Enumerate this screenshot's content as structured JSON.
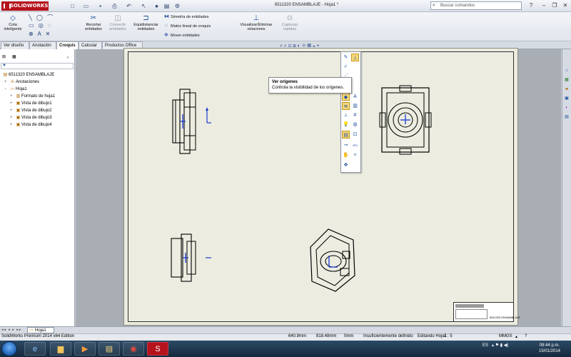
{
  "app": {
    "brand": "SOLIDWORKS",
    "doc_title": "6511320 ENSAMBLAJE - Hoja1 *"
  },
  "search": {
    "placeholder": "Buscar comandos"
  },
  "ribbon": {
    "cota_label": "Cota inteligente",
    "recortar_label": "Recortar entidades",
    "convertir_label": "Convertir entidades",
    "equidistanciar_label": "Equidistanciar entidades",
    "simetria_label": "Simetría de entidades",
    "matriz_label": "Matriz lineal de croquis",
    "mover_label": "Mover entidades",
    "relaciones_label": "Visualizar/Eliminar relaciones",
    "capturas_label": "Capturas rápidas"
  },
  "tabs": [
    "Ver diseño",
    "Anotación",
    "Croquis",
    "Calcular",
    "Productos Office"
  ],
  "tree": {
    "root": "6511320 ENSAMBLAJE",
    "items": [
      "Anotaciones",
      "Hoja1",
      "Formato de hoja1",
      "Vista de dibujo1",
      "Vista de dibujo2",
      "Vista de dibujo3",
      "Vista de dibujo4"
    ]
  },
  "tooltip": {
    "title": "Ver orígenes",
    "description": "Controla la visibilidad de los orígenes."
  },
  "palette": {
    "jpg_label": "JPG"
  },
  "titleblock": {
    "text": "6511320 ENSAMBLAJE"
  },
  "sheet_tab": "Hoja1",
  "status": {
    "edition": "SolidWorks Premium 2014 x64 Edition",
    "x": "640.9mm",
    "y": "818.48mm",
    "z": "0mm",
    "state": "Insuficientemente definido",
    "editing": "Editando Hoja1",
    "scale": "1 : 5",
    "units": "MMGS"
  },
  "taskbar": {
    "lang": "ES",
    "time": "08:44 p.m.",
    "date": "15/01/2014"
  },
  "colors": {
    "accent": "#b5121b",
    "origin": "#1a3ccf"
  }
}
